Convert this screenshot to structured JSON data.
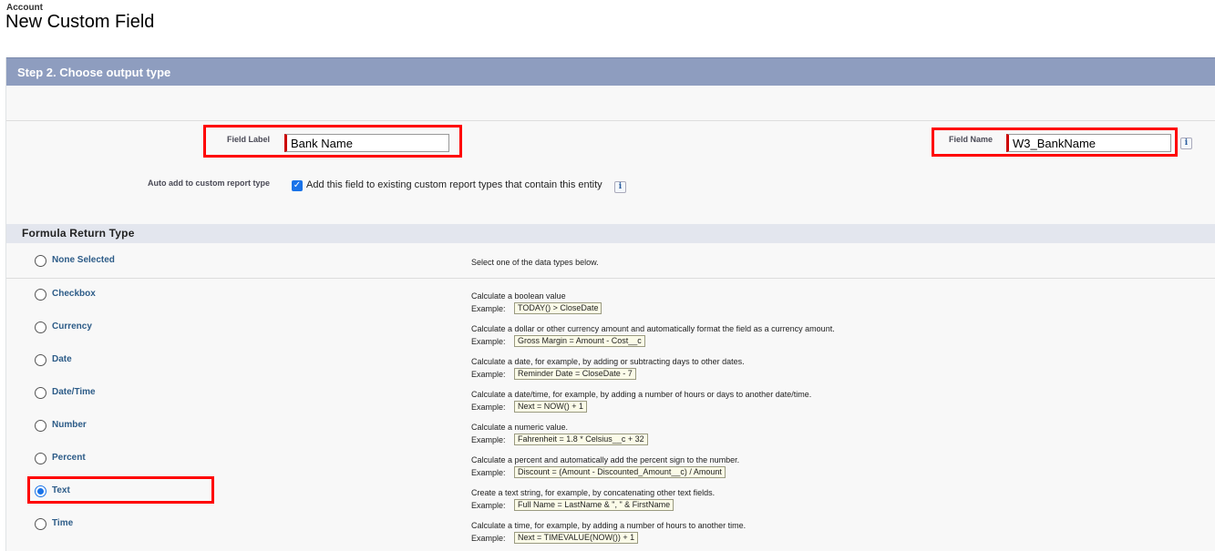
{
  "header": {
    "object": "Account",
    "title": "New Custom Field"
  },
  "step": {
    "title": "Step 2. Choose output type"
  },
  "fields": {
    "label": {
      "label": "Field Label",
      "value": "Bank Name"
    },
    "name": {
      "label": "Field Name",
      "value": "W3_BankName"
    },
    "auto_add": {
      "label": "Auto add to custom report type",
      "checkbox_label": "Add this field to existing custom report types that contain this entity",
      "checked": true
    }
  },
  "formula": {
    "title": "Formula Return Type",
    "example_word": "Example:",
    "none": {
      "label": "None Selected",
      "desc": "Select one of the data types below."
    },
    "types": [
      {
        "label": "Checkbox",
        "desc": "Calculate a boolean value",
        "example": "TODAY() > CloseDate",
        "selected": false
      },
      {
        "label": "Currency",
        "desc": "Calculate a dollar or other currency amount and automatically format the field as a currency amount.",
        "example": "Gross Margin = Amount - Cost__c",
        "selected": false
      },
      {
        "label": "Date",
        "desc": "Calculate a date, for example, by adding or subtracting days to other dates.",
        "example": "Reminder Date = CloseDate - 7",
        "selected": false
      },
      {
        "label": "Date/Time",
        "desc": "Calculate a date/time, for example, by adding a number of hours or days to another date/time.",
        "example": "Next = NOW() + 1",
        "selected": false
      },
      {
        "label": "Number",
        "desc": "Calculate a numeric value.",
        "example": "Fahrenheit = 1.8 * Celsius__c + 32",
        "selected": false
      },
      {
        "label": "Percent",
        "desc": "Calculate a percent and automatically add the percent sign to the number.",
        "example": "Discount = (Amount - Discounted_Amount__c) / Amount",
        "selected": false
      },
      {
        "label": "Text",
        "desc": "Create a text string, for example, by concatenating other text fields.",
        "example": "Full Name = LastName & \", \" & FirstName",
        "selected": true
      },
      {
        "label": "Time",
        "desc": "Calculate a time, for example, by adding a number of hours to another time.",
        "example": "Next = TIMEVALUE(NOW()) + 1",
        "selected": false
      }
    ]
  },
  "icons": {
    "info": "info-icon",
    "check": "check-icon"
  }
}
